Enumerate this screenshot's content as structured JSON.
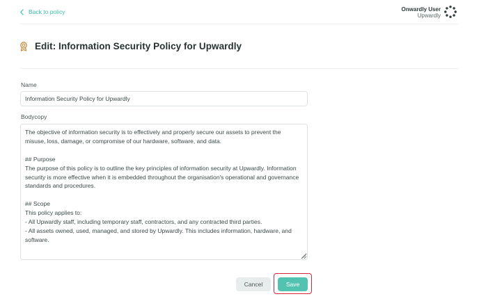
{
  "nav": {
    "back_label": "Back to policy"
  },
  "user": {
    "name": "Onwardly User",
    "org": "Upwardly"
  },
  "header": {
    "title": "Edit: Information Security Policy for Upwardly"
  },
  "form": {
    "name_label": "Name",
    "name_value": "Information Security Policy for Upwardly",
    "body_label": "Bodycopy",
    "body_value": "The objective of information security is to effectively and properly secure our assets to prevent the misuse, loss, damage, or compromise of our hardware, software, and data.\n\n## Purpose\nThe purpose of this policy is to outline the key principles of information security at Upwardly. Information security is more effective when it is embedded throughout the organisation's operational and governance standards and procedures.\n\n## Scope\nThis policy applies to:\n- All Upwardly staff, including temporary staff, contractors, and any contracted third parties.\n- All assets owned, used, managed, and stored by Upwardly. This includes information, hardware, and software."
  },
  "actions": {
    "cancel_label": "Cancel",
    "save_label": "Save"
  },
  "colors": {
    "accent": "#52c3b0",
    "link": "#3bbfa8",
    "highlight": "#d6283b",
    "title_icon": "#c98a3a"
  },
  "icons": {
    "back": "chevron-left-icon",
    "title": "award-badge-icon",
    "avatar": "org-ring-logo"
  }
}
